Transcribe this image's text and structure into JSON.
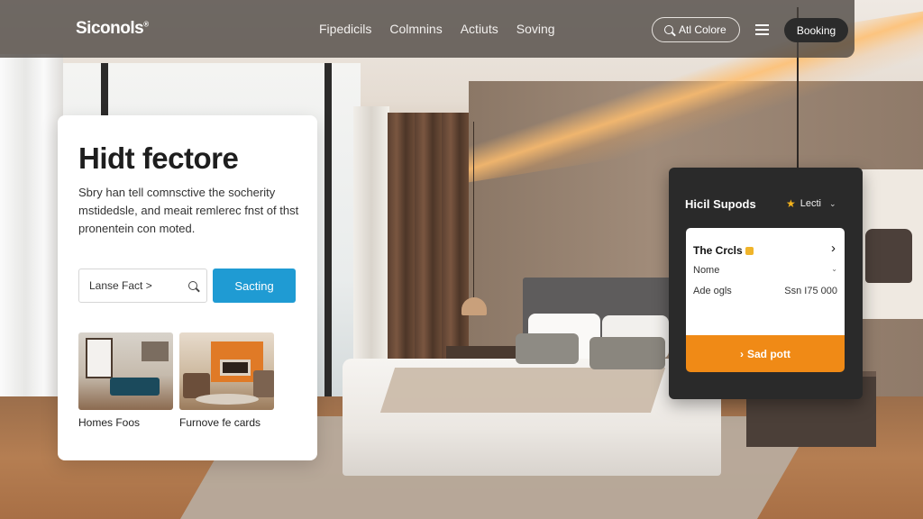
{
  "nav": {
    "logo": "Siconols",
    "logo_mark": "®",
    "links": [
      "Fipedicils",
      "Colmnins",
      "Actiuts",
      "Soving"
    ],
    "explore_label": "Atl Colore",
    "booking_label": "Booking"
  },
  "hero": {
    "title": "Hidt fectore",
    "description": "Sbry han tell comnsctive the socherity mstidedsle, and meait remlerec fnst of thst pronentein con moted.",
    "search_value": "Lanse Fact >",
    "search_button": "Sacting",
    "thumbnails": [
      {
        "caption": "Homes Foos"
      },
      {
        "caption": "Furnove fe cards"
      }
    ]
  },
  "panel": {
    "title": "Hicil Supods",
    "location": "Lecti",
    "card": {
      "heading": "The Crcls",
      "row1_label": "Nome",
      "row2_label": "Ade ogls",
      "row2_value": "Ssn I75 000"
    },
    "cta_label": "Sad pott"
  },
  "colors": {
    "accent_blue": "#1f9bd3",
    "accent_orange": "#f08a16",
    "panel_dark": "#2a2a2a"
  }
}
